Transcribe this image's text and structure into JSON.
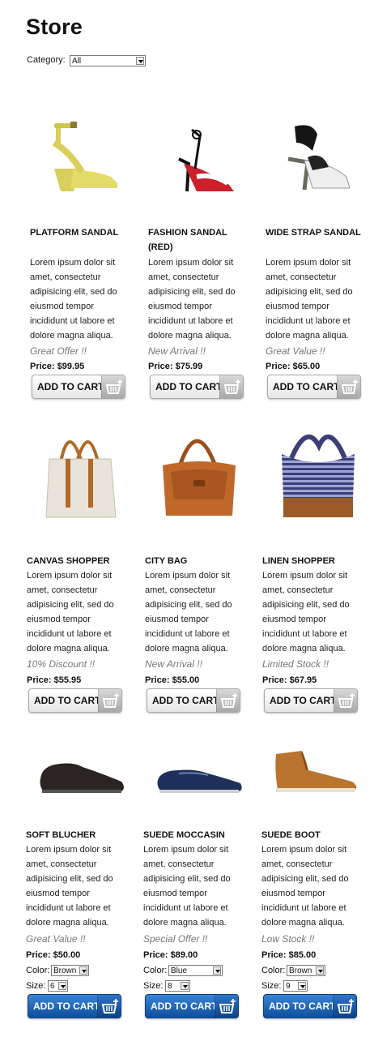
{
  "store": {
    "title": "Store",
    "category_label": "Category:",
    "category_value": "All"
  },
  "products": [
    {
      "name": "PLATFORM SANDAL",
      "description": "Lorem ipsum dolor sit amet, consectetur adipisicing elit, sed do eiusmod tempor incididunt ut labore et dolore magna aliqua.",
      "promo": "Great Offer !!",
      "price": "Price: $99.95",
      "button": "ADD TO CART",
      "image": "yellow-platform-sandal"
    },
    {
      "name": "FASHION SANDAL (RED)",
      "description": "Lorem ipsum dolor sit amet, consectetur adipisicing elit, sed do eiusmod tempor incididunt ut labore et dolore magna aliqua.",
      "promo": "New Arrival !!",
      "price": "Price: $75.99",
      "button": "ADD TO CART",
      "image": "red-fashion-sandal"
    },
    {
      "name": "WIDE STRAP SANDAL",
      "description": "Lorem ipsum dolor sit amet, consectetur adipisicing elit, sed do eiusmod tempor incididunt ut labore et dolore magna aliqua.",
      "promo": "Great Value !!",
      "price": "Price: $65.00",
      "button": "ADD TO CART",
      "image": "wide-strap-sandal"
    },
    {
      "name": "CANVAS SHOPPER",
      "description": "Lorem ipsum dolor sit amet, consectetur adipisicing elit, sed do eiusmod tempor incididunt ut labore et dolore magna aliqua.",
      "promo": "10% Discount !!",
      "price": "Price: $55.95",
      "button": "ADD TO CART",
      "image": "canvas-tote-bag"
    },
    {
      "name": "CITY BAG",
      "description": "Lorem ipsum dolor sit amet, consectetur adipisicing elit, sed do eiusmod tempor incididunt ut labore et dolore magna aliqua.",
      "promo": "New Arrival !!",
      "price": "Price: $55.00",
      "button": "ADD TO CART",
      "image": "tan-city-bag"
    },
    {
      "name": "LINEN SHOPPER",
      "description": "Lorem ipsum dolor sit amet, consectetur adipisicing elit, sed do eiusmod tempor incididunt ut labore et dolore magna aliqua.",
      "promo": "Limited Stock !!",
      "price": "Price: $67.95",
      "button": "ADD TO CART",
      "image": "striped-linen-bag"
    },
    {
      "name": "SOFT BLUCHER",
      "description": "Lorem ipsum dolor sit amet, consectetur adipisicing elit, sed do eiusmod tempor incididunt ut labore et dolore magna aliqua.",
      "promo": "Great Value !!",
      "price": "Price: $50.00",
      "button": "ADD TO CART",
      "image": "black-blucher-shoe",
      "color_label": "Color:",
      "color_value": "Brown",
      "size_label": "Size:",
      "size_value": "6"
    },
    {
      "name": "SUEDE MOCCASIN",
      "description": "Lorem ipsum dolor sit amet, consectetur adipisicing elit, sed do eiusmod tempor incididunt ut labore et dolore magna aliqua.",
      "promo": "Special Offer !!",
      "price": "Price: $89.00",
      "button": "ADD TO CART",
      "image": "blue-suede-moccasin",
      "color_label": "Color:",
      "color_value": "Blue",
      "size_label": "Size:",
      "size_value": "8"
    },
    {
      "name": "SUEDE BOOT",
      "description": "Lorem ipsum dolor sit amet, consectetur adipisicing elit, sed do eiusmod tempor incididunt ut labore et dolore magna aliqua.",
      "promo": "Low Stock !!",
      "price": "Price: $85.00",
      "button": "ADD TO CART",
      "image": "tan-suede-boot",
      "color_label": "Color:",
      "color_value": "Brown",
      "size_label": "Size:",
      "size_value": "9"
    }
  ],
  "colors": {
    "promo_text": "#777777",
    "button_blue": "#1f63b8",
    "button_grey": "#e6e6e6"
  }
}
